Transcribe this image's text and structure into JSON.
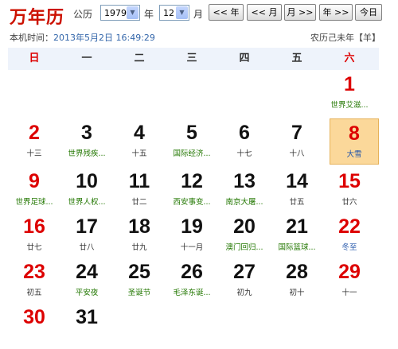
{
  "app_title": "万年历",
  "controls": {
    "year_label": "公历",
    "year_value": "1979",
    "year_unit": "年",
    "month_value": "12",
    "month_unit": "月",
    "prev_year": "<< 年",
    "prev_month": "<< 月",
    "next_month": "月 >>",
    "next_year": "年 >>",
    "today": "今日"
  },
  "local_time_label": "本机时间：",
  "local_time_value": "2013年5月2日 16:49:29",
  "lunar_year": "农历己未年【羊】",
  "weekdays": [
    "日",
    "一",
    "二",
    "三",
    "四",
    "五",
    "六"
  ],
  "days": [
    {
      "day": "1",
      "sub": "世界艾滋..."
    },
    {
      "day": "2",
      "sub": "十三"
    },
    {
      "day": "3",
      "sub": "世界残疾..."
    },
    {
      "day": "4",
      "sub": "十五"
    },
    {
      "day": "5",
      "sub": "国际经济..."
    },
    {
      "day": "6",
      "sub": "十七"
    },
    {
      "day": "7",
      "sub": "十八"
    },
    {
      "day": "8",
      "sub": "大雪"
    },
    {
      "day": "9",
      "sub": "世界足球..."
    },
    {
      "day": "10",
      "sub": "世界人权..."
    },
    {
      "day": "11",
      "sub": "廿二"
    },
    {
      "day": "12",
      "sub": "西安事变..."
    },
    {
      "day": "13",
      "sub": "南京大屠..."
    },
    {
      "day": "14",
      "sub": "廿五"
    },
    {
      "day": "15",
      "sub": "廿六"
    },
    {
      "day": "16",
      "sub": "廿七"
    },
    {
      "day": "17",
      "sub": "廿八"
    },
    {
      "day": "18",
      "sub": "廿九"
    },
    {
      "day": "19",
      "sub": "十一月"
    },
    {
      "day": "20",
      "sub": "澳门回归..."
    },
    {
      "day": "21",
      "sub": "国际篮球..."
    },
    {
      "day": "22",
      "sub": "冬至"
    },
    {
      "day": "23",
      "sub": "初五"
    },
    {
      "day": "24",
      "sub": "平安夜"
    },
    {
      "day": "25",
      "sub": "圣诞节"
    },
    {
      "day": "26",
      "sub": "毛泽东诞..."
    },
    {
      "day": "27",
      "sub": "初九"
    },
    {
      "day": "28",
      "sub": "初十"
    },
    {
      "day": "29",
      "sub": "十一"
    },
    {
      "day": "30",
      "sub": ""
    },
    {
      "day": "31",
      "sub": ""
    }
  ],
  "colors": {
    "weekend": "#dd0000",
    "festival": "#227700",
    "solar_term": "#2255aa",
    "highlight": "#fbd89a"
  }
}
